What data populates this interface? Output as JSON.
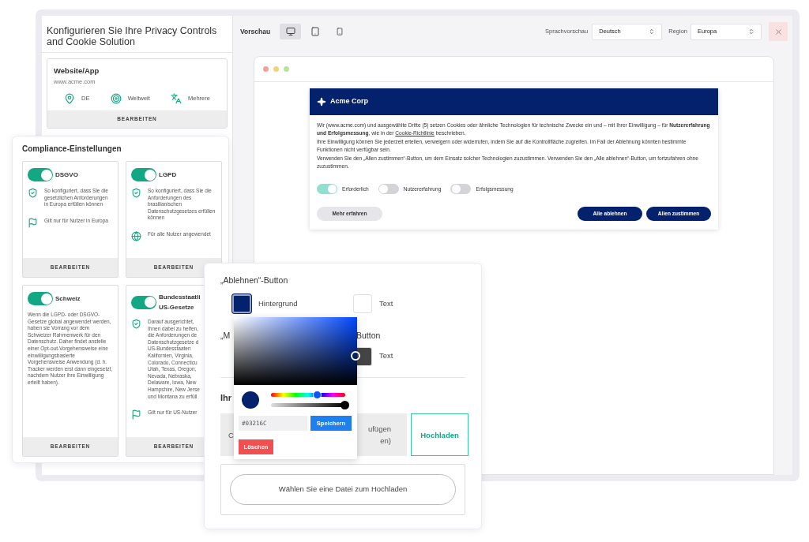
{
  "header": {
    "title": "Konfigurieren Sie Ihre Privacy Controls and Cookie Solution"
  },
  "website_card": {
    "title": "Website/App",
    "url": "www.acme.com",
    "facts": [
      {
        "kind": "location",
        "label": "DE"
      },
      {
        "kind": "scope",
        "label": "Weltweit"
      },
      {
        "kind": "language",
        "label": "Mehrere"
      }
    ],
    "button": "BEARBEITEN"
  },
  "preview_toolbar": {
    "label": "Vorschau",
    "devices": [
      {
        "kind": "desktop",
        "selected": true
      },
      {
        "kind": "tablet",
        "selected": false
      },
      {
        "kind": "phone",
        "selected": false
      }
    ],
    "language_label": "Sprachvorschau",
    "language": "Deutsch",
    "region_label": "Region",
    "region": "Europa"
  },
  "banner": {
    "brand": "Acme Corp",
    "paragraphs": [
      {
        "text": "Wir (www.acme.com) und ausgewählte Dritte (5) setzen Cookies oder ähnliche Technologien für technische Zwecke ein und – mit Ihrer Einwilligung – für **Nutzererfahrung und Erfolgsmessung**, wie in der",
        "link": "Cookie-Richtlinie",
        "after": "beschrieben."
      },
      {
        "text": "Ihre Einwilligung können Sie jederzeit erteilen, verweigern oder widerrufen, indem Sie auf die Kontrollfläche zugreifen. Im Fall der Ablehnung könnten bestimmte Funktionen nicht verfügbar sein."
      },
      {
        "text": "Verwenden Sie den „Allen zustimmen“-Button, um dem Einsatz solcher Technologien zuzustimmen. Verwenden Sie den „Alle ablehnen“-Button, um fortzufahren ohne zuzustimmen."
      }
    ],
    "toggles": [
      {
        "label": "Erforderlich",
        "on": true,
        "disabled": true
      },
      {
        "label": "Nutzererfahrung",
        "on": false,
        "disabled": false
      },
      {
        "label": "Erfolgsmessung",
        "on": false,
        "disabled": false
      }
    ],
    "buttons": [
      {
        "kind": "secondary",
        "label": "Mehr erfahren"
      },
      {
        "kind": "primary",
        "label": "Alle ablehnen"
      },
      {
        "kind": "primary",
        "label": "Allen zustimmen"
      }
    ]
  },
  "compliance": {
    "title": "Compliance-Einstellungen",
    "cards": [
      {
        "title_lines": [
          "DSGVO"
        ],
        "on": true,
        "items": [
          {
            "kind": "shield",
            "text": "So konfiguriert, dass Sie die gesetzlichen Anforderungen in Europa erfüllen können"
          },
          {
            "kind": "flag",
            "text": "Gilt nur für Nutzer in Europa"
          }
        ],
        "button": "BEARBEITEN"
      },
      {
        "title_lines": [
          "LGPD"
        ],
        "on": true,
        "items": [
          {
            "kind": "shield",
            "text": "So konfiguriert, dass Sie die Anforderungen des brasilianischen Datenschutzgesetzes erfüllen können"
          },
          {
            "kind": "globe",
            "text": "Für alle Nutzer angewendet"
          }
        ],
        "button": "BEARBEITEN"
      },
      {
        "title_lines": [
          "Schweiz"
        ],
        "on": true,
        "items": [
          {
            "kind": "text",
            "text": "Wenn die LGPD- oder DSGVO-Gesetze global angewendet werden, haben sie Vorrang vor dem Schweizer Rahmenwerk für den Datenschutz. Daher findet anstelle einer Opt-out-Vorgehensweise eine einwilligungsbasierte Vorgehensweise Anwendung (d. h. Tracker werden erst dann eingesetzt, nachdem Nutzer ihre Einwilligung erteilt haben)."
          }
        ],
        "button": "BEARBEITEN"
      },
      {
        "title_lines": [
          "Bundesstaatli",
          "US-Gesetze"
        ],
        "on": true,
        "items": [
          {
            "kind": "shield",
            "lines": [
              "Darauf ausgerichtet,",
              "Ihnen dabei zu helfen,",
              "die Anforderungen de",
              "Datenschutzgesetze d",
              "US-Bundesstaaten",
              "Kalifornien, Virginia,",
              "Colorado, Connecticu",
              "Utah, Texas, Oregon,",
              "Nevada, Nebraska,",
              "Delaware, Iowa, New",
              "Hampshire, New Jerse",
              "und Montana zu erfüll"
            ]
          },
          {
            "kind": "flag",
            "text": "Gilt nur für US-Nutzer"
          }
        ],
        "button": "BEARBEITEN"
      }
    ]
  },
  "color_editor": {
    "heading": "„Ablehnen“-Button",
    "swatches": [
      {
        "label": "Hintergrund",
        "color": "#03216c",
        "selected": true
      },
      {
        "label": "Text",
        "color": "#ffffff",
        "selected": false
      }
    ],
    "heading_2_start": "„M",
    "heading_2_end": "Button",
    "swatches_2": [
      {
        "label": "Text",
        "color": "#444444",
        "selected": false
      }
    ],
    "section_heading": "Ihr",
    "tabs": [
      {
        "lines": [
          "C"
        ],
        "selected": false
      },
      {
        "lines": [
          "ufügen",
          "en)"
        ],
        "selected": false
      },
      {
        "lines": [
          "Hochladen"
        ],
        "selected": true
      }
    ],
    "upload_button": "Wählen Sie eine Datei zum Hochladen",
    "picker": {
      "color": "#03216c",
      "hue": {
        "level": 0.62
      },
      "alpha": {
        "level": 1
      },
      "hex": "#03216C",
      "save": "Speichern",
      "clear": "Löschen"
    }
  }
}
